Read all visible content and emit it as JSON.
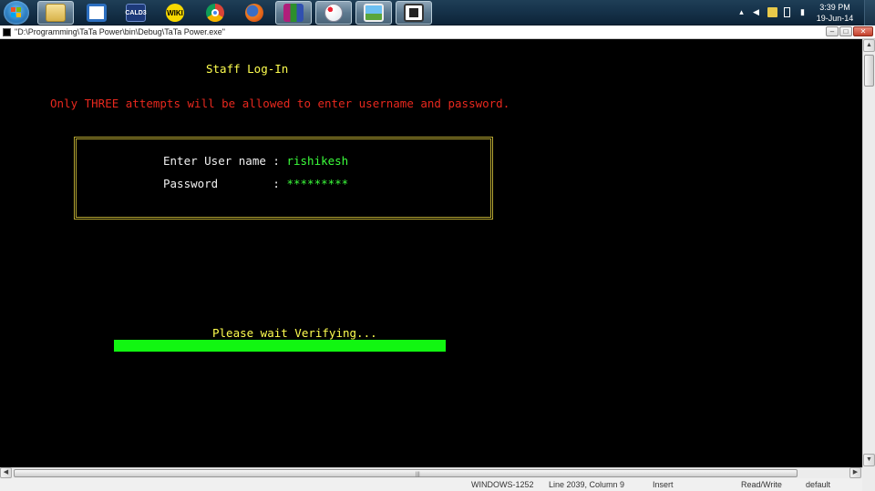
{
  "taskbar": {
    "apps": [
      {
        "name": "Windows Explorer",
        "label": ""
      },
      {
        "name": "Visual Studio",
        "label": ""
      },
      {
        "name": "CALD3",
        "label": "CALD3"
      },
      {
        "name": "WikiTaxi",
        "label": "WIKI"
      },
      {
        "name": "Chrome",
        "label": ""
      },
      {
        "name": "Firefox",
        "label": ""
      },
      {
        "name": "WinRAR",
        "label": ""
      },
      {
        "name": "Paint",
        "label": ""
      },
      {
        "name": "Photo Viewer",
        "label": ""
      },
      {
        "name": "Console Window",
        "label": ""
      }
    ],
    "clock": {
      "time": "3:39 PM",
      "date": "19-Jun-14"
    }
  },
  "window": {
    "title": "\"D:\\Programming\\TaTa Power\\bin\\Debug\\TaTa Power.exe\""
  },
  "console": {
    "heading": "Staff Log-In",
    "warning": "Only THREE attempts will be allowed to enter username and password.",
    "username_label": "Enter User name : ",
    "username_value": "rishikesh",
    "password_label": "Password        : ",
    "password_value": "*********",
    "status_message": "Please wait Verifying...",
    "progress_fraction": 1.0
  },
  "statusbar": {
    "encoding": "WINDOWS-1252",
    "position": "Line 2039, Column 9",
    "mode": "Insert",
    "access": "Read/Write",
    "profile": "default"
  },
  "colors": {
    "heading": "#ffff4f",
    "warning": "#e8281e",
    "input": "#3cff3c",
    "progress": "#11f611",
    "box_border": "#b5a531"
  }
}
